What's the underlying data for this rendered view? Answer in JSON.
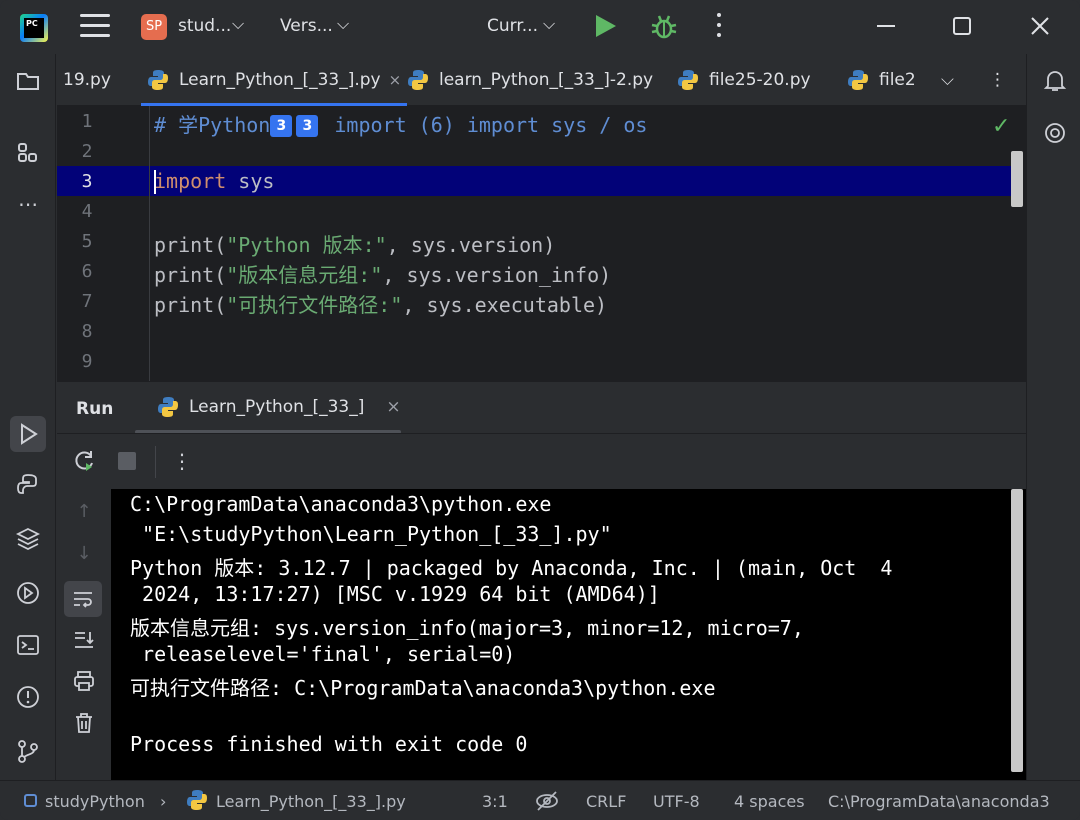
{
  "titlebar": {
    "logo_text": "PC",
    "project_badge": "SP",
    "project_name": "stud...",
    "vcs_label": "Vers...",
    "run_config": "Curr..."
  },
  "tabs": [
    {
      "label": "19.py"
    },
    {
      "label": "Learn_Python_[_33_].py",
      "close": "×"
    },
    {
      "label": "learn_Python_[_33_]-2.py"
    },
    {
      "label": "file25-20.py"
    },
    {
      "label": "file2"
    }
  ],
  "editor": {
    "line_numbers": [
      "1",
      "2",
      "3",
      "4",
      "5",
      "6",
      "7",
      "8",
      "9"
    ],
    "line1": {
      "hash": "# 学Python",
      "badge1": "3",
      "badge2": "3",
      "rest": " import (6) import sys / os"
    },
    "line3": {
      "kw": "import",
      "rest": " sys"
    },
    "line5": {
      "fn": "print(",
      "str": "\"Python 版本:\"",
      "rest": ", sys.version)"
    },
    "line6": {
      "fn": "print(",
      "str": "\"版本信息元组:\"",
      "rest": ", sys.version_info)"
    },
    "line7": {
      "fn": "print(",
      "str": "\"可执行文件路径:\"",
      "rest": ", sys.executable)"
    },
    "check": "✓"
  },
  "run_panel": {
    "title": "Run",
    "tab_label": "Learn_Python_[_33_]",
    "tab_close": "×"
  },
  "console": {
    "lines": [
      "C:\\ProgramData\\anaconda3\\python.exe",
      " \"E:\\studyPython\\Learn_Python_[_33_].py\"",
      "Python 版本: 3.12.7 | packaged by Anaconda, Inc. | (main, Oct  4",
      " 2024, 13:17:27) [MSC v.1929 64 bit (AMD64)]",
      "版本信息元组: sys.version_info(major=3, minor=12, micro=7,",
      " releaselevel='final', serial=0)",
      "可执行文件路径: C:\\ProgramData\\anaconda3\\python.exe",
      "",
      "Process finished with exit code 0"
    ]
  },
  "statusbar": {
    "project": "studyPython",
    "file": "Learn_Python_[_33_].py",
    "position": "3:1",
    "line_sep": "CRLF",
    "encoding": "UTF-8",
    "indent": "4 spaces",
    "interpreter": "C:\\ProgramData\\anaconda3"
  },
  "colors": {
    "accent": "#3574f0",
    "run_green": "#5fb865",
    "highlight_row": "#020278",
    "string": "#6aab73",
    "keyword": "#cf8e6d"
  }
}
